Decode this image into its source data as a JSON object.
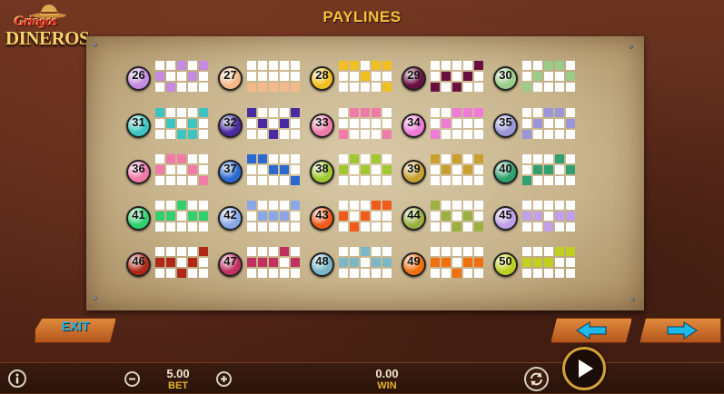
{
  "game": {
    "title": "PAYLINES",
    "logo_line1": "Gringos",
    "logo_line2": "DINEROS",
    "colors": {
      "title": "#f2c23a",
      "accent_arrow": "#1fb9e8",
      "bet_label": "#e6b22c"
    }
  },
  "paylines": [
    {
      "number": "26",
      "color": "#c48be0",
      "pattern": [
        [
          0,
          0,
          1,
          0,
          1
        ],
        [
          1,
          0,
          0,
          1,
          0
        ],
        [
          0,
          1,
          0,
          0,
          0
        ]
      ]
    },
    {
      "number": "27",
      "color": "#f3b98a",
      "pattern": [
        [
          0,
          0,
          0,
          0,
          0
        ],
        [
          0,
          0,
          0,
          0,
          0
        ],
        [
          1,
          1,
          1,
          1,
          1
        ]
      ]
    },
    {
      "number": "28",
      "color": "#f0c020",
      "pattern": [
        [
          1,
          1,
          0,
          1,
          1
        ],
        [
          0,
          0,
          1,
          0,
          0
        ],
        [
          0,
          0,
          0,
          0,
          1
        ]
      ]
    },
    {
      "number": "29",
      "color": "#6a1040",
      "pattern": [
        [
          0,
          0,
          0,
          0,
          1
        ],
        [
          0,
          1,
          0,
          1,
          0
        ],
        [
          1,
          0,
          1,
          0,
          0
        ]
      ]
    },
    {
      "number": "30",
      "color": "#9ccc8a",
      "pattern": [
        [
          0,
          0,
          1,
          1,
          0
        ],
        [
          0,
          1,
          0,
          0,
          1
        ],
        [
          1,
          0,
          0,
          0,
          0
        ]
      ]
    },
    {
      "number": "31",
      "color": "#3cc4c0",
      "pattern": [
        [
          1,
          0,
          0,
          0,
          1
        ],
        [
          0,
          1,
          0,
          1,
          0
        ],
        [
          0,
          0,
          1,
          1,
          0
        ]
      ]
    },
    {
      "number": "32",
      "color": "#4a2aa0",
      "pattern": [
        [
          1,
          0,
          0,
          0,
          1
        ],
        [
          0,
          1,
          0,
          1,
          0
        ],
        [
          0,
          0,
          1,
          0,
          0
        ]
      ]
    },
    {
      "number": "33",
      "color": "#f07aa8",
      "pattern": [
        [
          0,
          1,
          1,
          1,
          0
        ],
        [
          0,
          0,
          0,
          0,
          0
        ],
        [
          1,
          0,
          0,
          0,
          1
        ]
      ]
    },
    {
      "number": "34",
      "color": "#f07ad8",
      "pattern": [
        [
          0,
          0,
          1,
          1,
          1
        ],
        [
          0,
          1,
          0,
          0,
          0
        ],
        [
          1,
          0,
          0,
          0,
          0
        ]
      ]
    },
    {
      "number": "35",
      "color": "#9a96d8",
      "pattern": [
        [
          0,
          0,
          1,
          1,
          0
        ],
        [
          0,
          1,
          0,
          0,
          1
        ],
        [
          1,
          0,
          0,
          0,
          0
        ]
      ]
    },
    {
      "number": "36",
      "color": "#f07aa8",
      "pattern": [
        [
          0,
          1,
          1,
          0,
          0
        ],
        [
          1,
          0,
          0,
          1,
          0
        ],
        [
          0,
          0,
          0,
          0,
          1
        ]
      ]
    },
    {
      "number": "37",
      "color": "#2a6ad0",
      "pattern": [
        [
          1,
          1,
          0,
          0,
          0
        ],
        [
          0,
          0,
          1,
          1,
          0
        ],
        [
          0,
          0,
          0,
          0,
          1
        ]
      ]
    },
    {
      "number": "38",
      "color": "#a0c830",
      "pattern": [
        [
          0,
          1,
          0,
          1,
          0
        ],
        [
          1,
          0,
          1,
          0,
          1
        ],
        [
          0,
          0,
          0,
          0,
          0
        ]
      ]
    },
    {
      "number": "39",
      "color": "#c8a030",
      "pattern": [
        [
          1,
          0,
          1,
          0,
          1
        ],
        [
          0,
          1,
          0,
          1,
          0
        ],
        [
          0,
          0,
          0,
          0,
          0
        ]
      ]
    },
    {
      "number": "40",
      "color": "#30a070",
      "pattern": [
        [
          0,
          0,
          0,
          1,
          0
        ],
        [
          0,
          1,
          1,
          0,
          1
        ],
        [
          1,
          0,
          0,
          0,
          0
        ]
      ]
    },
    {
      "number": "41",
      "color": "#30d070",
      "pattern": [
        [
          0,
          0,
          1,
          0,
          0
        ],
        [
          1,
          1,
          0,
          1,
          1
        ],
        [
          0,
          0,
          0,
          0,
          0
        ]
      ]
    },
    {
      "number": "42",
      "color": "#8aa8e8",
      "pattern": [
        [
          1,
          0,
          0,
          0,
          1
        ],
        [
          0,
          1,
          1,
          1,
          0
        ],
        [
          0,
          0,
          0,
          0,
          0
        ]
      ]
    },
    {
      "number": "43",
      "color": "#f05a1a",
      "pattern": [
        [
          0,
          0,
          0,
          1,
          1
        ],
        [
          1,
          0,
          1,
          0,
          0
        ],
        [
          0,
          1,
          0,
          0,
          0
        ]
      ]
    },
    {
      "number": "44",
      "color": "#9ab040",
      "pattern": [
        [
          1,
          0,
          0,
          0,
          0
        ],
        [
          0,
          1,
          0,
          1,
          0
        ],
        [
          0,
          0,
          1,
          0,
          1
        ]
      ]
    },
    {
      "number": "45",
      "color": "#c0a0e8",
      "pattern": [
        [
          0,
          0,
          0,
          0,
          0
        ],
        [
          1,
          1,
          0,
          1,
          1
        ],
        [
          0,
          0,
          1,
          0,
          0
        ]
      ]
    },
    {
      "number": "46",
      "color": "#b02818",
      "pattern": [
        [
          0,
          0,
          0,
          0,
          1
        ],
        [
          1,
          1,
          0,
          1,
          0
        ],
        [
          0,
          0,
          1,
          0,
          0
        ]
      ]
    },
    {
      "number": "47",
      "color": "#c03060",
      "pattern": [
        [
          0,
          0,
          0,
          1,
          0
        ],
        [
          1,
          1,
          1,
          0,
          1
        ],
        [
          0,
          0,
          0,
          0,
          0
        ]
      ]
    },
    {
      "number": "48",
      "color": "#7ab8c8",
      "pattern": [
        [
          0,
          0,
          1,
          0,
          0
        ],
        [
          1,
          1,
          0,
          1,
          1
        ],
        [
          0,
          0,
          0,
          0,
          0
        ]
      ]
    },
    {
      "number": "49",
      "color": "#f07010",
      "pattern": [
        [
          0,
          0,
          0,
          0,
          0
        ],
        [
          1,
          1,
          0,
          1,
          1
        ],
        [
          0,
          0,
          1,
          0,
          0
        ]
      ]
    },
    {
      "number": "50",
      "color": "#c0d020",
      "pattern": [
        [
          0,
          0,
          0,
          1,
          1
        ],
        [
          1,
          1,
          1,
          0,
          0
        ],
        [
          0,
          0,
          0,
          0,
          0
        ]
      ]
    }
  ],
  "controls": {
    "exit_label": "EXIT",
    "bet_value": "5.00",
    "bet_label": "BET",
    "win_value": "0.00",
    "win_label": "WIN"
  }
}
